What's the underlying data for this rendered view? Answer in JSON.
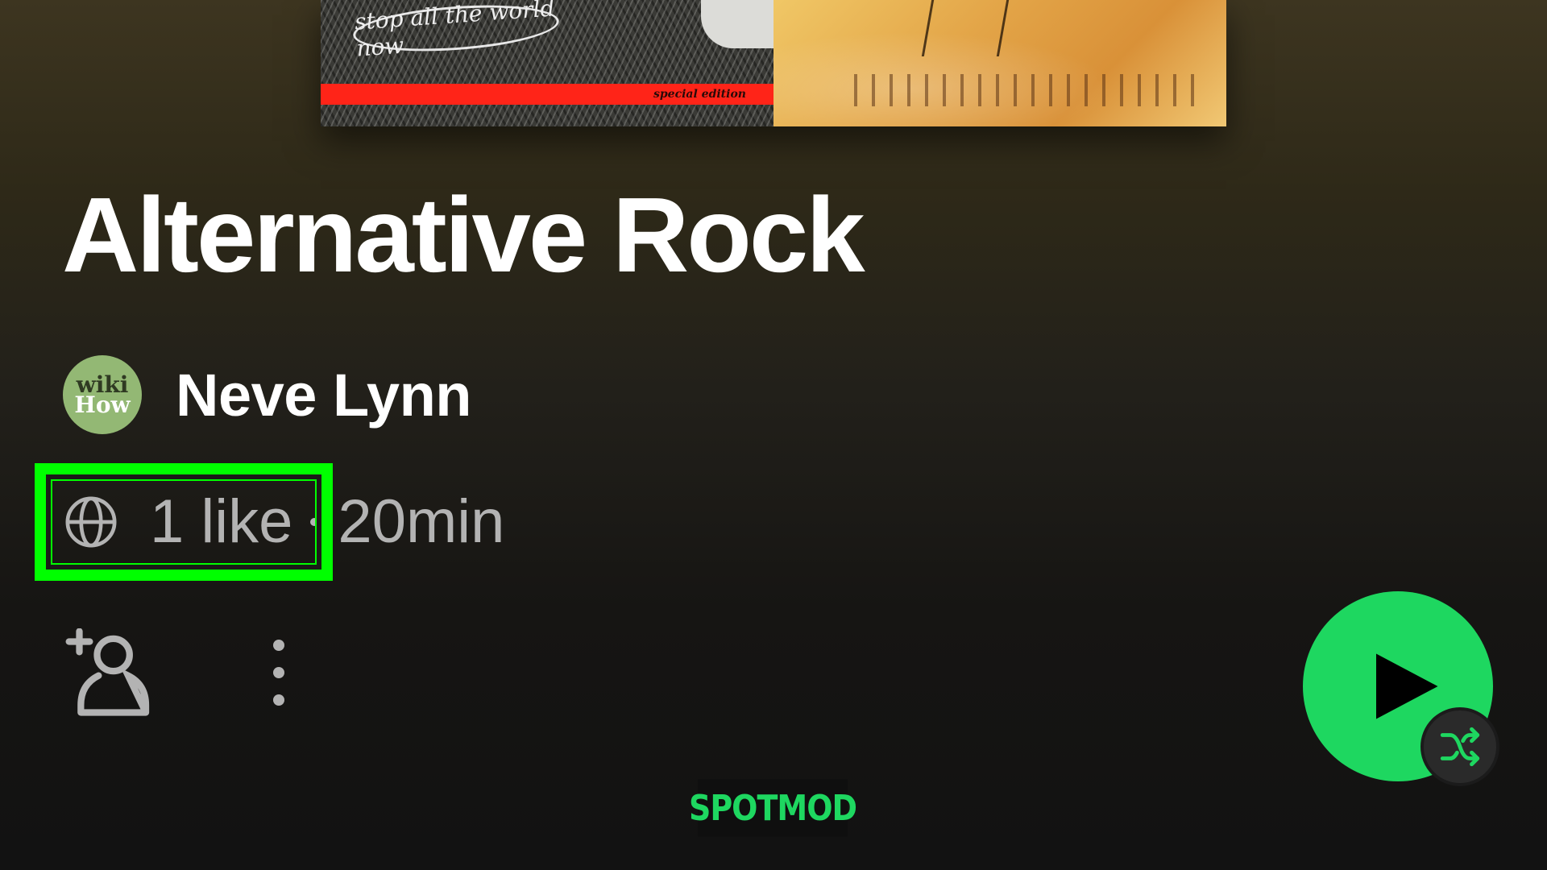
{
  "cover": {
    "left_tile_scribble": "stop all the world now",
    "left_tile_band_text": "special edition"
  },
  "playlist": {
    "title": "Alternative Rock",
    "owner": {
      "name": "Neve Lynn",
      "avatar_line1": "wiki",
      "avatar_line2": "How"
    },
    "visibility_icon": "globe-icon",
    "likes": "1 like",
    "duration": "20min"
  },
  "actions": {
    "follow_icon": "add-user-icon",
    "more_icon": "more-vertical-icon",
    "play_icon": "play-icon",
    "shuffle_icon": "shuffle-icon"
  },
  "colors": {
    "play_button": "#1ed760",
    "highlight": "#00ff00",
    "secondary_text": "#b3b3b3"
  },
  "watermark": "SPOTMOD"
}
